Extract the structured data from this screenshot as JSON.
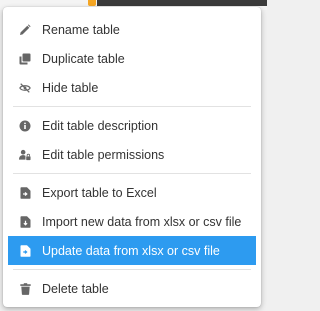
{
  "menu": {
    "items": [
      {
        "label": "Rename table",
        "icon": "pencil-icon"
      },
      {
        "label": "Duplicate table",
        "icon": "copy-icon"
      },
      {
        "label": "Hide table",
        "icon": "eye-slash-icon"
      },
      {
        "label": "Edit table description",
        "icon": "info-icon"
      },
      {
        "label": "Edit table permissions",
        "icon": "user-lock-icon"
      },
      {
        "label": "Export table to Excel",
        "icon": "file-export-icon"
      },
      {
        "label": "Import new data from xlsx or csv file",
        "icon": "file-import-icon"
      },
      {
        "label": "Update data from xlsx or csv file",
        "icon": "file-update-icon",
        "active": true
      },
      {
        "label": "Delete table",
        "icon": "trash-icon"
      }
    ]
  },
  "colors": {
    "highlight": "#2d9bf0",
    "text": "#333333",
    "icon": "#666666"
  }
}
